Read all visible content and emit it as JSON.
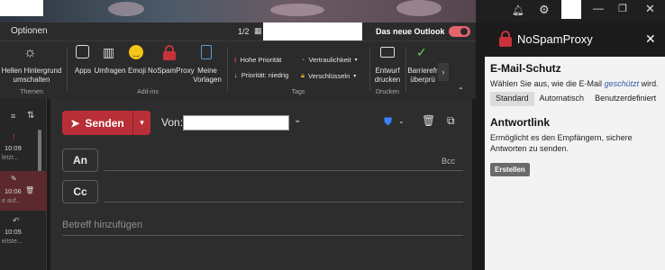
{
  "ribbon": {
    "tab_label": "Optionen",
    "page_indicator": "1/2",
    "new_outlook_label": "Das neue Outlook",
    "buttons": {
      "theme": "Hellen Hintergrund umschalten",
      "apps": "Apps",
      "polls": "Umfragen",
      "emoji": "Emoji",
      "nospamproxy": "NoSpamProxy",
      "my_templates": "Meine Vorlagen",
      "high_priority": "Hohe Priorität",
      "low_priority": "Priorität: niedrig",
      "confidentiality": "Vertraulichkeit",
      "encrypt": "Verschlüsseln",
      "print_draft": "Entwurf drucken",
      "accessibility": "Barrierefr überprü"
    },
    "groups": {
      "themes": "Themen",
      "addins": "Add-ins",
      "tags": "Tags",
      "print": "Drucken"
    }
  },
  "maillist": {
    "items": [
      {
        "time": "10:09",
        "snippet": "letzt..."
      },
      {
        "time": "10:06",
        "snippet": "e auf..."
      },
      {
        "time": "10:05",
        "snippet": "eitste..."
      }
    ]
  },
  "compose": {
    "send_label": "Senden",
    "from_label": "Von:",
    "to_label": "An",
    "cc_label": "Cc",
    "bcc_label": "Bcc",
    "subject_placeholder": "Betreff hinzufügen"
  },
  "nsp": {
    "title": "NoSpamProxy",
    "email_protection_heading": "E-Mail-Schutz",
    "email_protection_text_before": "Wählen Sie aus, wie die E-Mail ",
    "email_protection_link": "geschützt",
    "email_protection_text_after": " wird.",
    "tabs": [
      "Standard",
      "Automatisch",
      "Benutzerdefiniert"
    ],
    "active_tab": "Standard",
    "reply_heading": "Antwortlink",
    "reply_text": "Ermöglicht es den Empfängern, sichere Antworten zu senden.",
    "create_button": "Erstellen"
  },
  "colors": {
    "send": "#b92f37",
    "nsp_icon": "#c8323a",
    "toggle": "#e5636d"
  }
}
